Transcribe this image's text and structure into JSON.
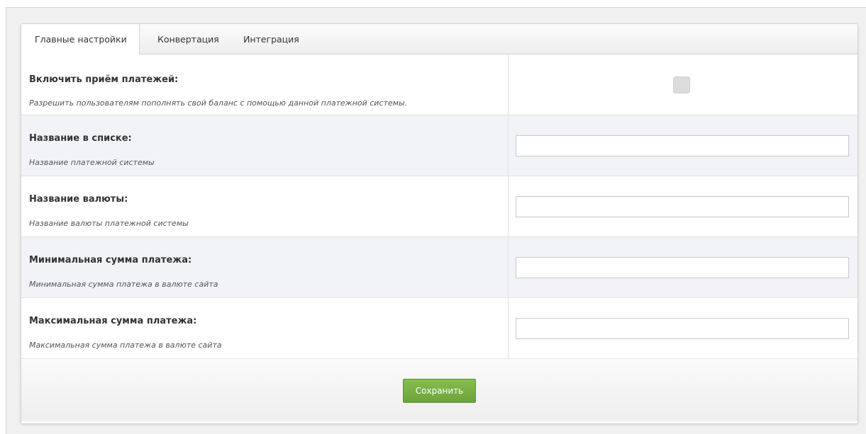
{
  "tabs": [
    {
      "label": "Главные настройки",
      "active": true
    },
    {
      "label": "Конвертация",
      "active": false
    },
    {
      "label": "Интеграция",
      "active": false
    }
  ],
  "settings": [
    {
      "label": "Включить приём платежей:",
      "description": "Разрешить пользователям пополнять свой баланс с помощью данной платежной системы.",
      "control": "checkbox",
      "checked": false
    },
    {
      "label": "Название в списке:",
      "description": "Название платежной системы",
      "control": "text",
      "value": ""
    },
    {
      "label": "Название валюты:",
      "description": "Название валюты платежной системы",
      "control": "text",
      "value": ""
    },
    {
      "label": "Минимальная сумма платежа:",
      "description": "Минимальная сумма платежа в валюте сайта",
      "control": "text",
      "value": ""
    },
    {
      "label": "Максимальная сумма платежа:",
      "description": "Максимальная сумма платежа в валюте сайта",
      "control": "text",
      "value": ""
    }
  ],
  "footer": {
    "save_label": "Сохранить"
  },
  "colors": {
    "save_button": "#7ab245",
    "alt_row": "#f2f3f6",
    "checkbox": "#dcdcdc"
  }
}
